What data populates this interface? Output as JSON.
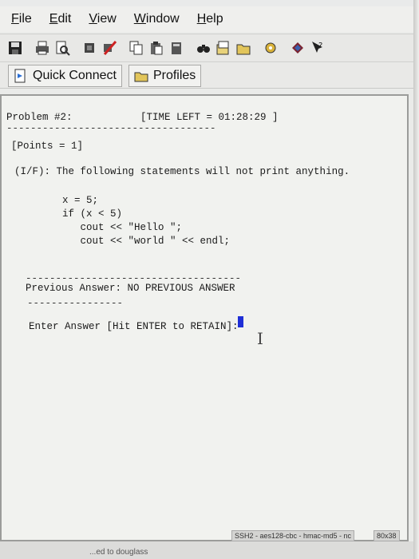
{
  "menu": {
    "items": [
      {
        "label": "File",
        "underline": "F",
        "rest": "ile"
      },
      {
        "label": "Edit",
        "underline": "E",
        "rest": "dit"
      },
      {
        "label": "View",
        "underline": "V",
        "rest": "iew"
      },
      {
        "label": "Window",
        "underline": "W",
        "rest": "indow"
      },
      {
        "label": "Help",
        "underline": "H",
        "rest": "elp"
      }
    ]
  },
  "toolbar": {
    "icons": [
      "save-icon",
      "print-icon",
      "print-preview-icon",
      "connect-icon",
      "disconnect-icon",
      "copy-icon",
      "paste-icon",
      "new-file-icon",
      "find-icon",
      "settings-icon",
      "keys-icon",
      "help-icon"
    ]
  },
  "profilebar": {
    "quick_connect_label": "Quick Connect",
    "profiles_label": "Profiles"
  },
  "terminal": {
    "problem_label": "Problem #2:",
    "time_left": "[TIME LEFT = 01:28:29 ]",
    "points": "[Points = 1]",
    "question": "(I/F): The following statements will not print anything.",
    "code": [
      "x = 5;",
      "if (x < 5)",
      "   cout << \"Hello \";",
      "   cout << \"world \" << endl;"
    ],
    "previous_answer": "Previous Answer: NO PREVIOUS ANSWER",
    "prompt": "Enter Answer [Hit ENTER to RETAIN]:"
  },
  "statusbar": {
    "connection_info": "SSH2 - aes128-cbc - hmac-md5 - nc",
    "size": "80x38",
    "footer": "...ed to douglass"
  },
  "colors": {
    "cursor": "#1f2fd6",
    "terminal_bg": "#f1f2ef"
  }
}
